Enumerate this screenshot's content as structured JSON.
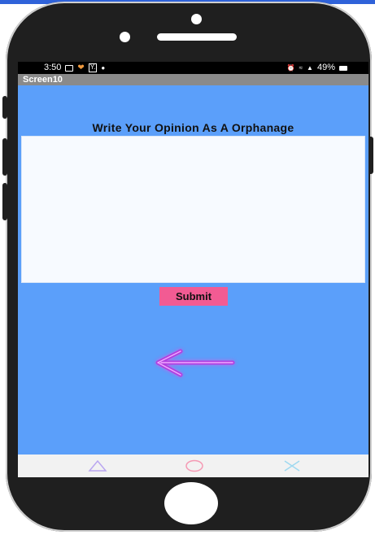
{
  "status_bar": {
    "time": "3:50",
    "battery": "49%"
  },
  "app": {
    "screen_title": "Screen10"
  },
  "content": {
    "heading": "Write Your Opinion As A Orphanage",
    "opinion_value": "",
    "submit_label": "Submit"
  },
  "icons": {
    "back": "arrow-left-icon",
    "nav": [
      "triangle-icon",
      "circle-icon",
      "cross-icon"
    ]
  },
  "colors": {
    "screen_bg": "#5b9ffa",
    "submit_bg": "#f25b93",
    "arrow": "#b040e0",
    "frame": "#1f1f1f"
  }
}
